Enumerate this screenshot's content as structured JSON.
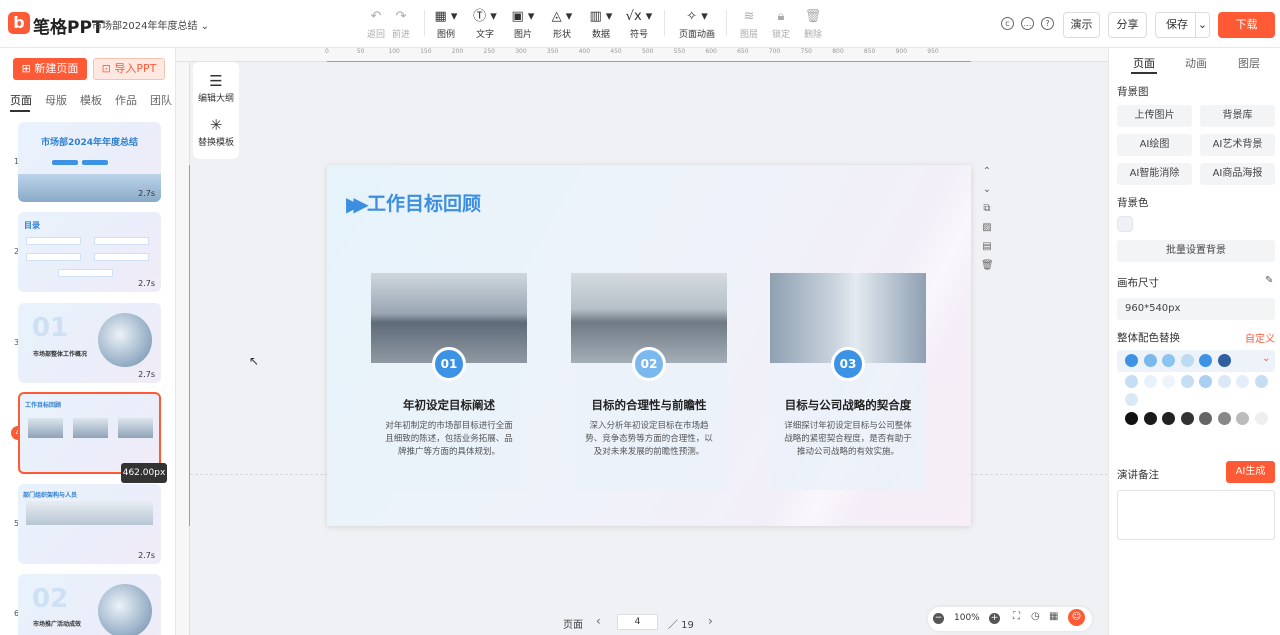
{
  "app": {
    "logo_letter": "b",
    "name": "笔格PPT",
    "doc_title": "市场部2024年年度总结"
  },
  "toolbar": {
    "undo": "返回",
    "redo": "前进",
    "chart": "图例",
    "text": "文字",
    "image": "图片",
    "shape": "形状",
    "data": "数据",
    "symbol": "符号",
    "page_animation": "页面动画",
    "layer": "图层",
    "lock": "锁定",
    "delete": "删除"
  },
  "header_actions": {
    "present": "演示",
    "share": "分享",
    "save": "保存",
    "download": "下载"
  },
  "left_panel": {
    "new_page": "新建页面",
    "import_ppt": "导入PPT",
    "tabs": [
      "页面",
      "母版",
      "模板",
      "作品",
      "团队"
    ],
    "thumbs": [
      {
        "num": "1",
        "title": "市场部2024年年度总结",
        "duration": "2.7s"
      },
      {
        "num": "2",
        "title": "目录",
        "duration": "2.7s"
      },
      {
        "num": "3",
        "title": "市场部整体工作概况",
        "big": "01",
        "duration": "2.7s"
      },
      {
        "num": "4",
        "title": "工作目标回顾",
        "duration": ""
      },
      {
        "num": "5",
        "title": "部门组织架构与人员",
        "duration": "2.7s"
      },
      {
        "num": "6",
        "title": "市场推广活动成效",
        "big": "02",
        "duration": ""
      }
    ],
    "size_badge": "462.00px"
  },
  "ruler_ticks": [
    "0",
    "50",
    "100",
    "150",
    "200",
    "250",
    "300",
    "350",
    "400",
    "450",
    "500",
    "550",
    "600",
    "650",
    "700",
    "750",
    "800",
    "850",
    "900",
    "950"
  ],
  "float_tools": {
    "outline": "编辑大纲",
    "replace": "替换模板"
  },
  "slide": {
    "title": "工作目标回顾",
    "cards": [
      {
        "num": "01",
        "title": "年初设定目标阐述",
        "body": "对年初制定的市场部目标进行全面且细致的陈述，包括业务拓展、品牌推广等方面的具体规划。"
      },
      {
        "num": "02",
        "title": "目标的合理性与前瞻性",
        "body": "深入分析年初设定目标在市场趋势、竞争态势等方面的合理性，以及对未来发展的前瞻性预测。"
      },
      {
        "num": "03",
        "title": "目标与公司战略的契合度",
        "body": "详细探讨年初设定目标与公司整体战略的紧密契合程度，是否有助于推动公司战略的有效实施。"
      }
    ]
  },
  "pager": {
    "label": "页面",
    "current": "4",
    "total": "／ 19",
    "prev": "‹",
    "next": "›"
  },
  "zoom": {
    "level": "100%",
    "minus": "−",
    "plus": "+"
  },
  "right_panel": {
    "tabs": [
      "页面",
      "动画",
      "图层"
    ],
    "background_image_label": "背景图",
    "bg_buttons": [
      "上传图片",
      "背景库",
      "AI绘图",
      "AI艺术背景",
      "AI智能消除",
      "AI商品海报"
    ],
    "background_color_label": "背景色",
    "batch_bg": "批量设置背景",
    "canvas_size_label": "画布尺寸",
    "canvas_size_value": "960*540px",
    "palette_label": "整体配色替换",
    "palette_custom": "自定义",
    "notes_label": "演讲备注",
    "ai_generate": "AI生成"
  },
  "colors": {
    "accent": "#ff5a36",
    "palette_row1": [
      "#3c93e6",
      "#7ab8ee",
      "#8cc4f0",
      "#bcdaf1",
      "#3c93e6",
      "#2f5f9e"
    ],
    "palette_row2": [
      "#c6def3",
      "#e8f1f9",
      "#eef4fa",
      "#c6def3",
      "#a9d0f0",
      "#dbe9f6",
      "#e4eef8",
      "#c6def3",
      "#dbe9f6"
    ],
    "palette_row3": [
      "#111111",
      "#1a1a1a",
      "#222222",
      "#333333",
      "#666666",
      "#888888",
      "#bbbbbb",
      "#eeeeee"
    ]
  }
}
